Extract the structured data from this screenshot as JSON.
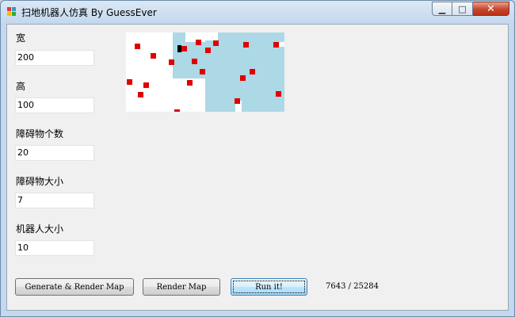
{
  "window": {
    "title": "扫地机器人仿真 By GuessEver",
    "min_glyph": "▁",
    "max_glyph": "□",
    "close_glyph": "✕"
  },
  "form": {
    "width_label": "宽",
    "width_value": "200",
    "height_label": "高",
    "height_value": "100",
    "obstacle_count_label": "障碍物个数",
    "obstacle_count_value": "20",
    "obstacle_size_label": "障碍物大小",
    "obstacle_size_value": "7",
    "robot_size_label": "机器人大小",
    "robot_size_value": "10"
  },
  "buttons": {
    "generate_render": "Generate & Render Map",
    "render": "Render Map",
    "run": "Run it!"
  },
  "progress_text": "7643 / 25284",
  "map": {
    "grid_width": 200,
    "grid_height": 100,
    "cleaned_color": "#add8e6",
    "free_color": "#ffffff",
    "obstacle_color": "#e00000",
    "robot_color": "#000000"
  }
}
